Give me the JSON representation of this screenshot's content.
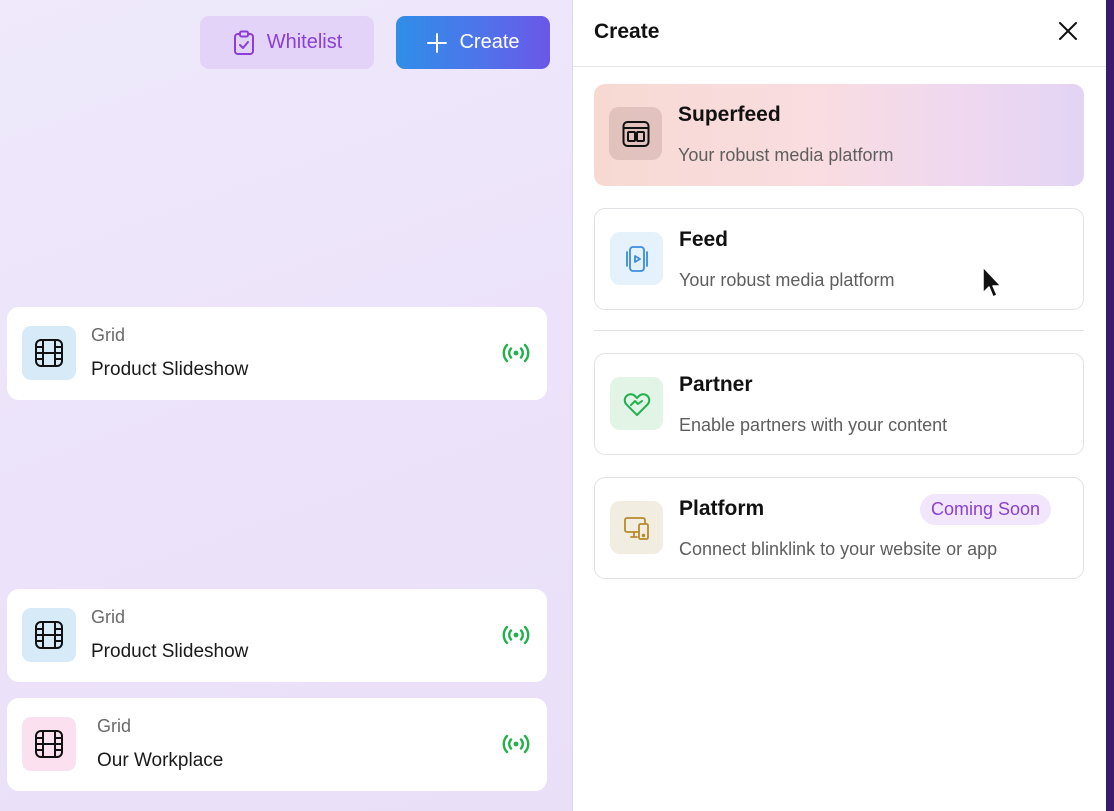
{
  "toolbar": {
    "whitelist_label": "Whitelist",
    "create_label": "Create"
  },
  "cards": [
    {
      "kind": "Grid",
      "title": "Product Slideshow",
      "thumb_color": "#d6eaf8",
      "status": "live"
    },
    {
      "kind": "Grid",
      "title": "Product Slideshow",
      "thumb_color": "#d6eaf8",
      "status": "live"
    },
    {
      "kind": "Grid",
      "title": "Our Workplace",
      "thumb_color": "#fbe0ef",
      "status": "live"
    }
  ],
  "panel": {
    "title": "Create",
    "options": [
      {
        "title": "Superfeed",
        "description": "Your robust media platform",
        "icon": "superfeed-icon"
      },
      {
        "title": "Feed",
        "description": "Your robust media platform",
        "icon": "feed-icon"
      },
      {
        "title": "Partner",
        "description": "Enable partners with your content",
        "icon": "partner-icon"
      },
      {
        "title": "Platform",
        "description": "Connect blinklink to your website or app",
        "icon": "platform-icon",
        "badge": "Coming Soon"
      }
    ]
  },
  "colors": {
    "accent_purple": "#8a3fd6",
    "create_gradient_start": "#2f8ee8",
    "create_gradient_end": "#6b57e8",
    "live_green": "#22b14c"
  }
}
